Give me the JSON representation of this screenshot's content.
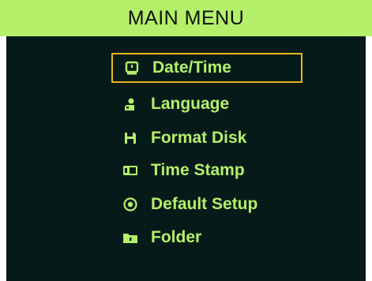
{
  "header": {
    "title": "MAIN MENU"
  },
  "menu": {
    "selected_index": 0,
    "items": [
      {
        "label": "Date/Time",
        "icon": "clock-icon"
      },
      {
        "label": "Language",
        "icon": "language-icon"
      },
      {
        "label": "Format Disk",
        "icon": "format-disk-icon"
      },
      {
        "label": "Time Stamp",
        "icon": "time-stamp-icon"
      },
      {
        "label": "Default Setup",
        "icon": "default-setup-icon"
      },
      {
        "label": "Folder",
        "icon": "folder-icon"
      }
    ]
  },
  "colors": {
    "header_bg": "#b4f06a",
    "body_bg": "#061a1a",
    "text": "#b4f06a",
    "selection_border": "#e3b81a"
  }
}
